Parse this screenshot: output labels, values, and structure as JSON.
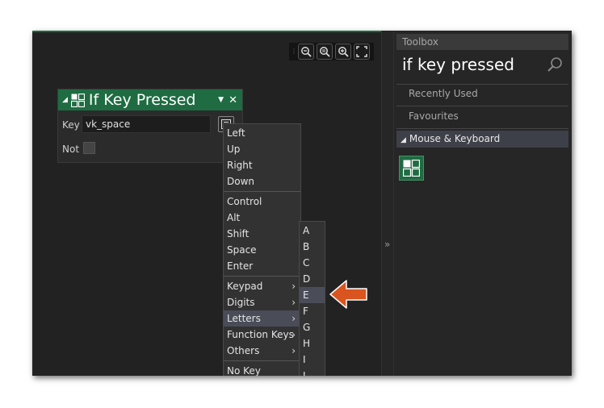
{
  "node": {
    "title": "If Key Pressed",
    "key_label": "Key",
    "key_value": "vk_space",
    "not_label": "Not"
  },
  "key_menu": {
    "items": [
      "Left",
      "Up",
      "Right",
      "Down",
      "Control",
      "Alt",
      "Shift",
      "Space",
      "Enter",
      "Keypad",
      "Digits",
      "Letters",
      "Function Keys",
      "Others",
      "No Key"
    ],
    "highlighted": "Letters"
  },
  "letters_menu": {
    "items": [
      "A",
      "B",
      "C",
      "D",
      "E",
      "F",
      "G",
      "H",
      "I",
      "J"
    ],
    "highlighted": "E"
  },
  "splitter": {
    "glyph": "»"
  },
  "toolbox": {
    "header": "Toolbox",
    "search_text": "if key pressed",
    "categories": [
      "Recently Used",
      "Favourites"
    ],
    "group": "Mouse & Keyboard"
  },
  "colors": {
    "node_header": "#1f6b42",
    "pointer_arrow": "#d9541e",
    "menu_highlight": "#4a4d58"
  }
}
